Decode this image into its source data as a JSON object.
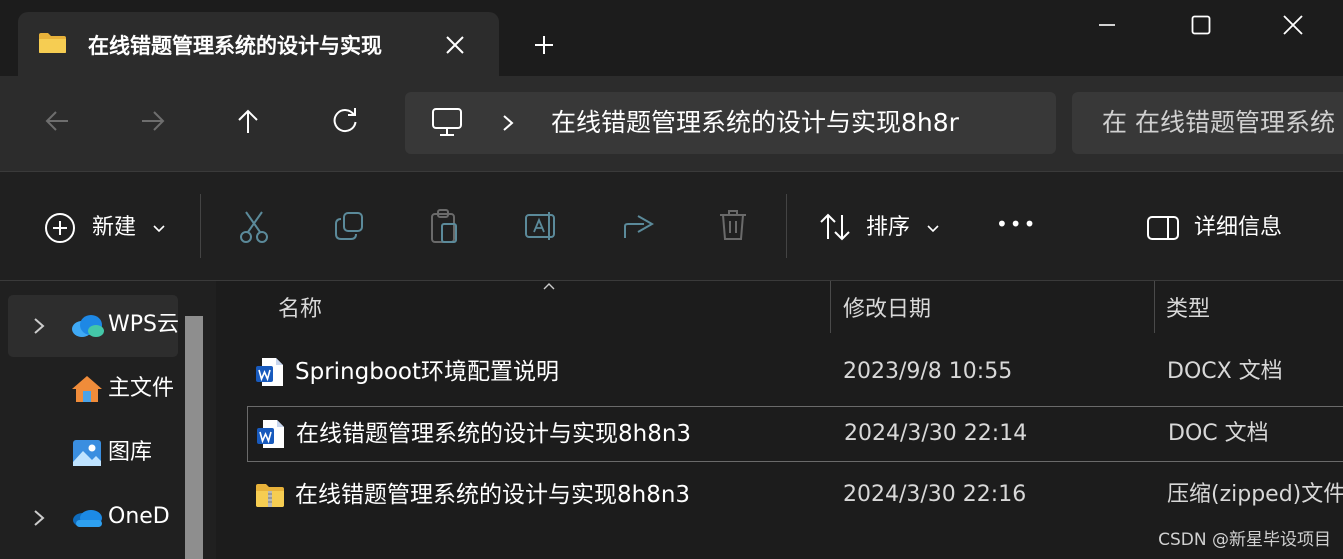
{
  "window": {
    "tab_title": "在线错题管理系统的设计与实现",
    "new_tab": "+",
    "colors": {
      "background": "#202020",
      "tab": "#2c2c2c",
      "address_bar": "#383838",
      "word_blue": "#185abd",
      "folder_yellow": "#f4c542"
    }
  },
  "address": {
    "path_text": "在线错题管理系统的设计与实现8h8r",
    "search_text": "在 在线错题管理系统"
  },
  "toolbar": {
    "new_label": "新建",
    "sort_label": "排序",
    "more_label": "•••",
    "details_label": "详细信息",
    "icons": [
      "cut-icon",
      "copy-icon",
      "paste-icon",
      "rename-icon",
      "share-icon",
      "delete-icon"
    ]
  },
  "sidebar": {
    "items": [
      {
        "label": "WPS云",
        "icon": "wps-cloud-icon",
        "expandable": true
      },
      {
        "label": "主文件",
        "icon": "home-icon",
        "expandable": false
      },
      {
        "label": "图库",
        "icon": "gallery-icon",
        "expandable": false
      },
      {
        "label": "OneD",
        "icon": "onedrive-icon",
        "expandable": true
      }
    ]
  },
  "columns": {
    "name": "名称",
    "modified": "修改日期",
    "type": "类型"
  },
  "files": [
    {
      "name": "Springboot环境配置说明",
      "date": "2023/9/8 10:55",
      "type": "DOCX 文档",
      "icon": "word-doc-icon"
    },
    {
      "name": "在线错题管理系统的设计与实现8h8n3",
      "date": "2024/3/30 22:14",
      "type": "DOC 文档",
      "icon": "word-doc-icon"
    },
    {
      "name": "在线错题管理系统的设计与实现8h8n3",
      "date": "2024/3/30 22:16",
      "type": "压缩(zipped)文件",
      "icon": "zip-folder-icon"
    }
  ],
  "watermark": "CSDN @新星毕设项目"
}
